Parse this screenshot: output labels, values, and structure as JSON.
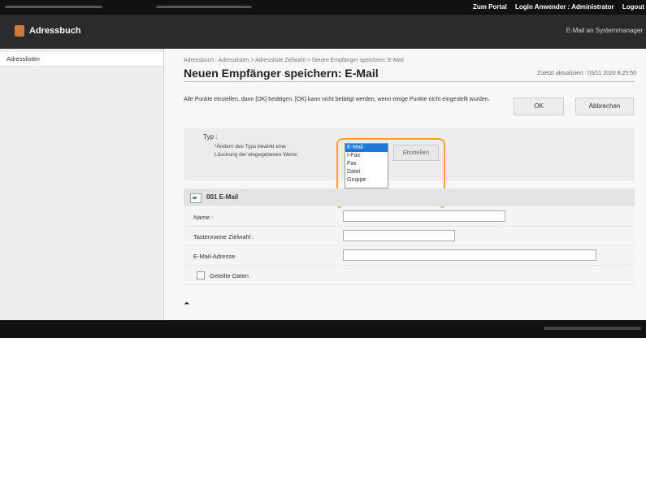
{
  "topbar": {
    "portal": "Zum Portal",
    "login": "Login Anwender : ",
    "user": "Administrator",
    "logout": "Logout"
  },
  "app": {
    "title": "Adressbuch",
    "mail_admin": "E-Mail an Systemmanager"
  },
  "sidebar": {
    "items": [
      {
        "label": "Adresslisten"
      }
    ]
  },
  "main": {
    "breadcrumb": "Adressbuch : Adresslisten > Adressliste Zielwahl > Neuen Empfänger speichern: E-Mail",
    "title": "Neuen Empfänger speichern: E-Mail",
    "updated": "Zuletzt aktualisiert : 03/11 2020 8:25:50",
    "info": "Alle Punkte einstellen, dann [OK] betätigen. [OK] kann nicht betätigt werden, wenn einige Punkte nicht eingestellt wurden.",
    "ok_label": "OK",
    "cancel_label": "Abbrechen"
  },
  "typ": {
    "label": "Typ :",
    "note": "*Ändern des Typs bewirkt eine Löschung der eingegebenen Werte.",
    "options": [
      "E-Mail",
      "I-Fax",
      "Fax",
      "Datei",
      "Gruppe"
    ],
    "selected": "E-Mail",
    "settings_label": "Einstellen"
  },
  "section": {
    "title": "001 E-Mail"
  },
  "fields": {
    "name_label": "Name :",
    "key_label": "Tastenname Zielwahl :",
    "email_label": "E-Mail-Adresse",
    "shared_label": "Geteilte Daten"
  },
  "totop": "⏶"
}
